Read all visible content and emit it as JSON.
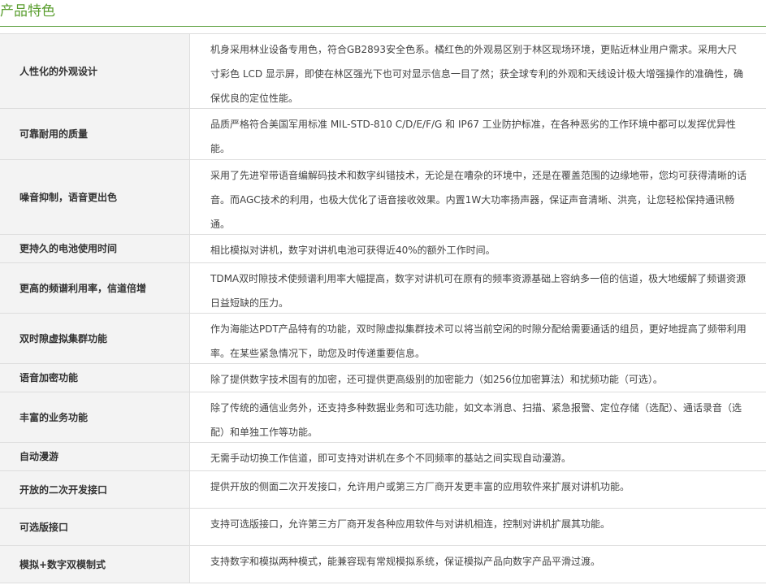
{
  "section": {
    "title": "产品特色"
  },
  "features": [
    {
      "name": "人性化的外观设计",
      "desc": "机身采用林业设备专用色，符合GB2893安全色系。橘红色的外观易区别于林区现场环境，更贴近林业用户需求。采用大尺寸彩色 LCD 显示屏，即使在林区强光下也可对显示信息一目了然；获全球专利的外观和天线设计极大增强操作的准确性，确保优良的定位性能。"
    },
    {
      "name": "可靠耐用的质量",
      "desc": "品质严格符合美国军用标准 MIL-STD-810 C/D/E/F/G 和 IP67 工业防护标准，在各种恶劣的工作环境中都可以发挥优异性能。"
    },
    {
      "name": "噪音抑制，语音更出色",
      "desc": "采用了先进窄带语音编解码技术和数字纠错技术，无论是在嘈杂的环境中，还是在覆盖范围的边缘地带，您均可获得清晰的话音。而AGC技术的利用，也极大优化了语音接收效果。内置1W大功率扬声器，保证声音清晰、洪亮，让您轻松保持通讯畅通。"
    },
    {
      "name": "更持久的电池使用时间",
      "desc": "相比模拟对讲机，数字对讲机电池可获得近40%的额外工作时间。"
    },
    {
      "name": "更高的频谱利用率，信道倍增",
      "desc": "TDMA双时隙技术使频谱利用率大幅提高，数字对讲机可在原有的频率资源基础上容纳多一倍的信道，极大地缓解了频谱资源日益短缺的压力。"
    },
    {
      "name": "双时隙虚拟集群功能",
      "desc": "作为海能达PDT产品特有的功能，双时隙虚拟集群技术可以将当前空闲的时隙分配给需要通话的组员，更好地提高了频带利用率。在某些紧急情况下，助您及时传递重要信息。"
    },
    {
      "name": "语音加密功能",
      "desc": "除了提供数字技术固有的加密，还可提供更高级别的加密能力（如256位加密算法）和扰频功能（可选）。"
    },
    {
      "name": "丰富的业务功能",
      "desc": "除了传统的通信业务外，还支持多种数据业务和可选功能，如文本消息、扫描、紧急报警、定位存储（选配）、通话录音（选配）和单独工作等功能。"
    },
    {
      "name": "自动漫游",
      "desc": "无需手动切换工作信道，即可支持对讲机在多个不同频率的基站之间实现自动漫游。"
    },
    {
      "name": "开放的二次开发接口",
      "desc": "提供开放的侧面二次开发接口，允许用户或第三方厂商开发更丰富的应用软件来扩展对讲机功能。"
    },
    {
      "name": "可选版接口",
      "desc": "支持可选版接口，允许第三方厂商开发各种应用软件与对讲机相连，控制对讲机扩展其功能。"
    },
    {
      "name": "模拟+数字双模制式",
      "desc": "支持数字和模拟两种模式，能兼容现有常规模拟系统，保证模拟产品向数字产品平滑过渡。"
    }
  ]
}
